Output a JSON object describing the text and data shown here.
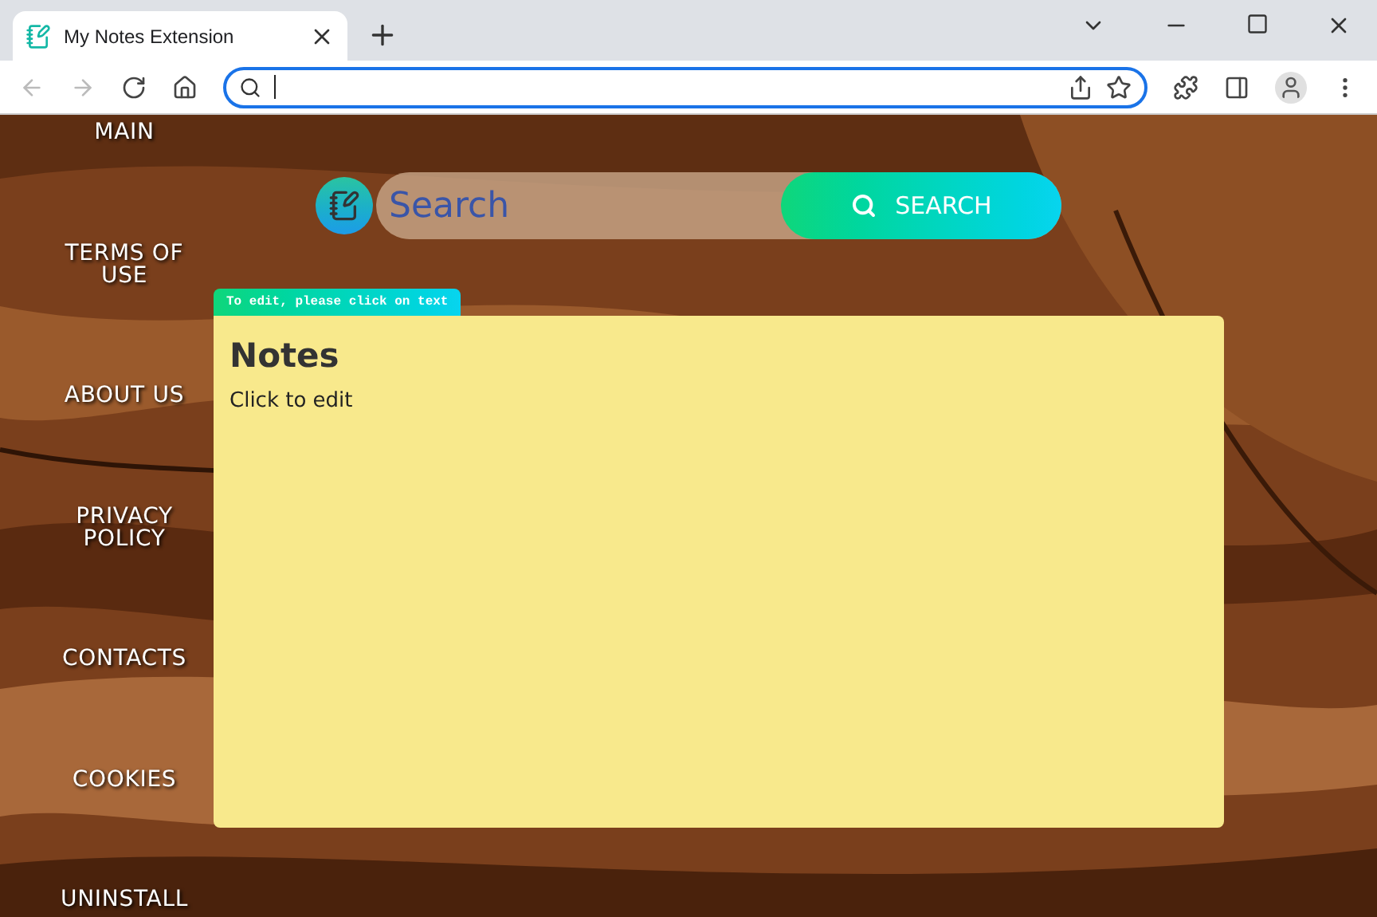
{
  "browser": {
    "tab_title": "My Notes Extension"
  },
  "nav": [
    "MAIN",
    "TERMS OF USE",
    "ABOUT US",
    "PRIVACY POLICY",
    "CONTACTS",
    "COOKIES",
    "UNINSTALL"
  ],
  "search": {
    "placeholder": "Search",
    "button": "SEARCH"
  },
  "hint": "To edit, please click on text",
  "note": {
    "title": "Notes",
    "body": "Click to edit"
  }
}
